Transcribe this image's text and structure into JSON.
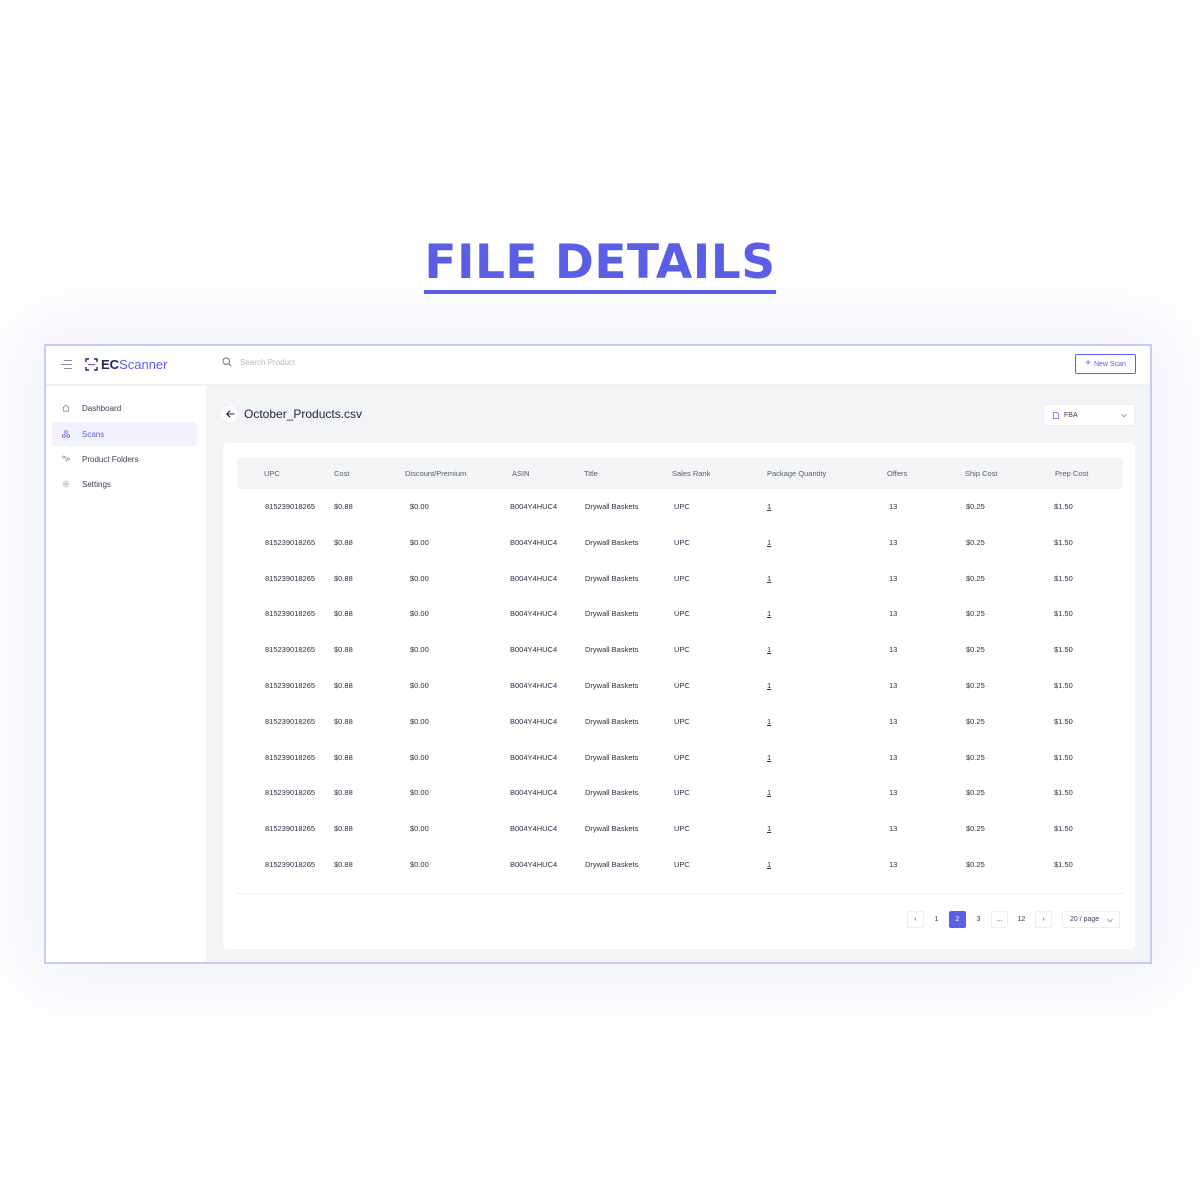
{
  "banner": {
    "title": "FILE DETAILS"
  },
  "app": {
    "logo_ec": "EC",
    "logo_scanner": "Scanner",
    "search_placeholder": "Search Product",
    "new_scan_label": "New Scan"
  },
  "sidebar": {
    "items": [
      {
        "label": "Dashboard",
        "icon": "home-icon",
        "active": false
      },
      {
        "label": "Scans",
        "icon": "scans-icon",
        "active": true
      },
      {
        "label": "Product Folders",
        "icon": "folders-icon",
        "active": false
      },
      {
        "label": "Settings",
        "icon": "gear-icon",
        "active": false
      }
    ]
  },
  "page": {
    "file_name": "October_Products.csv",
    "mode_select": "FBA"
  },
  "table": {
    "columns": [
      "UPC",
      "Cost",
      "Discount/Premium",
      "ASIN",
      "Title",
      "Sales Rank",
      "Package Quantity",
      "Offers",
      "Ship Cost",
      "Prep Cost"
    ],
    "rows": [
      [
        "815239018265",
        "$0.88",
        "$0.00",
        "B004Y4HUC4",
        "Drywall Baskets",
        "UPC",
        "1",
        "13",
        "$0.25",
        "$1.50"
      ],
      [
        "815239018265",
        "$0.88",
        "$0.00",
        "B004Y4HUC4",
        "Drywall Baskets",
        "UPC",
        "1",
        "13",
        "$0.25",
        "$1.50"
      ],
      [
        "815239018265",
        "$0.88",
        "$0.00",
        "B004Y4HUC4",
        "Drywall Baskets",
        "UPC",
        "1",
        "13",
        "$0.25",
        "$1.50"
      ],
      [
        "815239018265",
        "$0.88",
        "$0.00",
        "B004Y4HUC4",
        "Drywall Baskets",
        "UPC",
        "1",
        "13",
        "$0.25",
        "$1.50"
      ],
      [
        "815239018265",
        "$0.88",
        "$0.00",
        "B004Y4HUC4",
        "Drywall Baskets",
        "UPC",
        "1",
        "13",
        "$0.25",
        "$1.50"
      ],
      [
        "815239018265",
        "$0.88",
        "$0.00",
        "B004Y4HUC4",
        "Drywall Baskets",
        "UPC",
        "1",
        "13",
        "$0.25",
        "$1.50"
      ],
      [
        "815239018265",
        "$0.88",
        "$0.00",
        "B004Y4HUC4",
        "Drywall Baskets",
        "UPC",
        "1",
        "13",
        "$0.25",
        "$1.50"
      ],
      [
        "815239018265",
        "$0.88",
        "$0.00",
        "B004Y4HUC4",
        "Drywall Baskets",
        "UPC",
        "1",
        "13",
        "$0.25",
        "$1.50"
      ],
      [
        "815239018265",
        "$0.88",
        "$0.00",
        "B004Y4HUC4",
        "Drywall Baskets",
        "UPC",
        "1",
        "13",
        "$0.25",
        "$1.50"
      ],
      [
        "815239018265",
        "$0.88",
        "$0.00",
        "B004Y4HUC4",
        "Drywall Baskets",
        "UPC",
        "1",
        "13",
        "$0.25",
        "$1.50"
      ],
      [
        "815239018265",
        "$0.88",
        "$0.00",
        "B004Y4HUC4",
        "Drywall Baskets",
        "UPC",
        "1",
        "13",
        "$0.25",
        "$1.50"
      ]
    ]
  },
  "pagination": {
    "prev": "‹",
    "next": "›",
    "pages": [
      "1",
      "2",
      "3",
      "...",
      "12"
    ],
    "current": "2",
    "page_size": "20 / page"
  },
  "colors": {
    "accent": "#5b5fe6",
    "frame_border": "#c9cbf7"
  }
}
